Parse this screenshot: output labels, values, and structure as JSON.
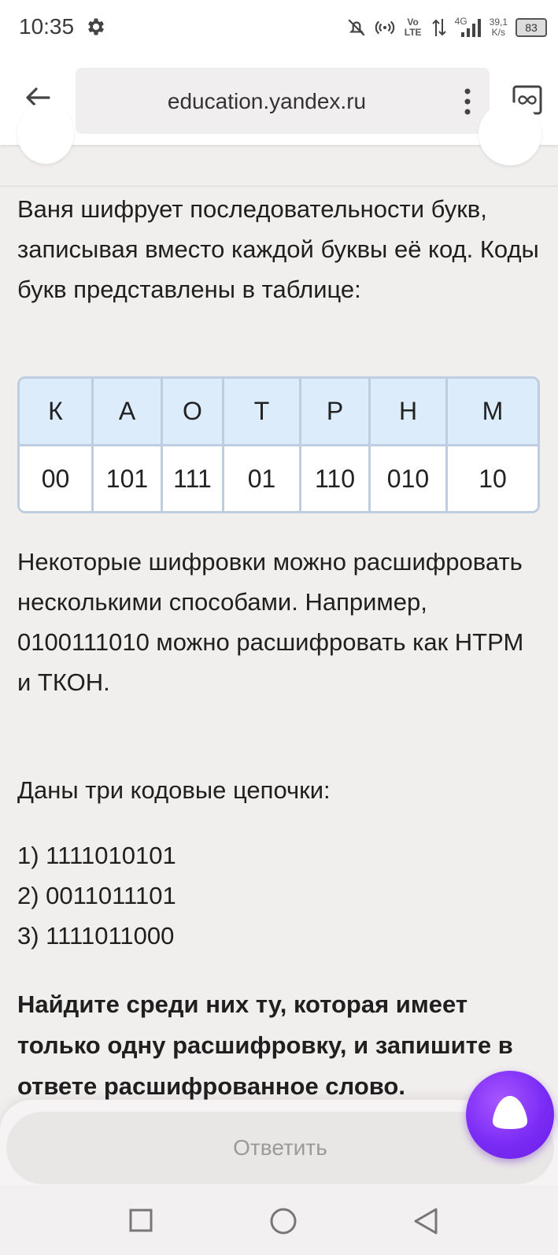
{
  "status_bar": {
    "time": "10:35",
    "network_type": "4G",
    "volte": "Vo LTE",
    "speed_value": "39,1",
    "speed_unit": "K/s",
    "battery": "83"
  },
  "browser": {
    "url": "education.yandex.ru"
  },
  "task": {
    "intro": "Ваня шифрует последовательности букв, записывая вместо каждой буквы её код. Коды букв представлены в таблице:",
    "table": {
      "letters": [
        "К",
        "А",
        "О",
        "Т",
        "Р",
        "Н",
        "М"
      ],
      "codes": [
        "00",
        "101",
        "111",
        "01",
        "110",
        "010",
        "10"
      ]
    },
    "example": "Некоторые шифровки можно расшифровать несколькими способами. Например, 0100111010 можно расшифровать как НТРМ и ТКОН.",
    "chains_intro": "Даны три кодовые цепочки:",
    "chains": [
      "1) 1111010101",
      "2) 0011011101",
      "3) 1111011000"
    ],
    "question": "Найдите среди них ту, которая имеет только одну расшифровку, и запишите в ответе расшифрованное слово."
  },
  "answer_button": "Ответить",
  "colors": {
    "table_header_bg": "#dcecfa",
    "table_border": "#bfcde0",
    "alice_purple": "#7a2cf5"
  }
}
